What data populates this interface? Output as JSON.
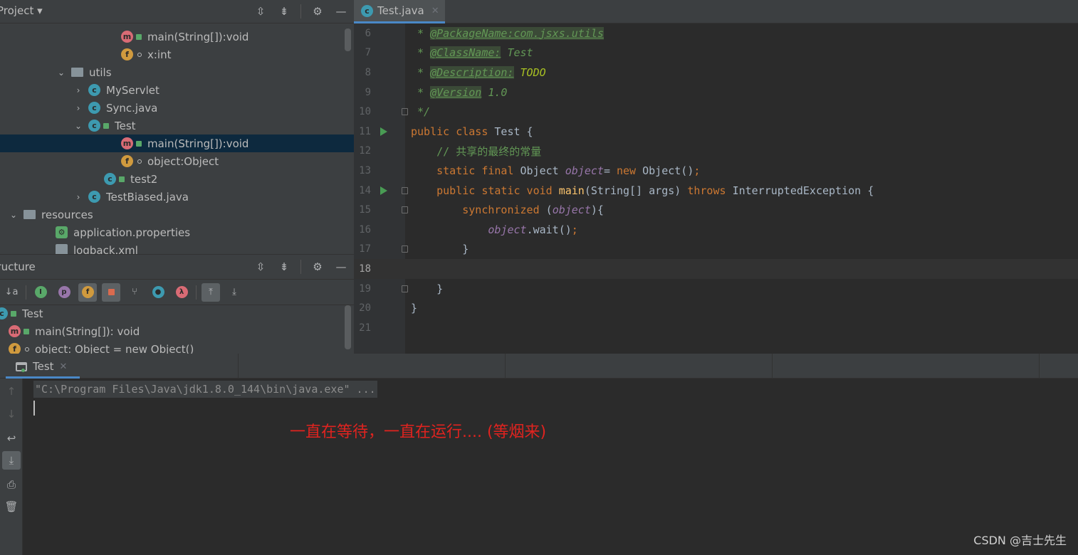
{
  "project_panel": {
    "title": "Project",
    "tree": [
      {
        "label": "main(String[]):void",
        "kind": "m",
        "lock": true
      },
      {
        "label": "x:int",
        "kind": "f",
        "dot": true
      },
      {
        "label": "utils",
        "kind": "folder",
        "arrow": "down"
      },
      {
        "label": "MyServlet",
        "kind": "c",
        "arrow": "right"
      },
      {
        "label": "Sync.java",
        "kind": "c",
        "arrow": "right"
      },
      {
        "label": "Test",
        "kind": "c",
        "arrow": "down",
        "lock": true
      },
      {
        "label": "main(String[]):void",
        "kind": "m",
        "lock": true,
        "selected": true
      },
      {
        "label": "object:Object",
        "kind": "f",
        "dot": true
      },
      {
        "label": "test2",
        "kind": "c",
        "lock": true
      },
      {
        "label": "TestBiased.java",
        "kind": "c",
        "arrow": "right"
      },
      {
        "label": "resources",
        "kind": "folder",
        "arrow": "down"
      },
      {
        "label": "application.properties",
        "kind": "props"
      },
      {
        "label": "logback.xml",
        "kind": "xml"
      }
    ]
  },
  "structure_panel": {
    "title": "Structure",
    "items": [
      {
        "label": "Test",
        "kind": "c"
      },
      {
        "label": "main(String[]): void",
        "kind": "m"
      },
      {
        "label": "object: Object = new Object()",
        "kind": "f"
      }
    ]
  },
  "editor": {
    "tab_label": "Test.java",
    "lines": [
      {
        "n": "6"
      },
      {
        "n": "7"
      },
      {
        "n": "8"
      },
      {
        "n": "9"
      },
      {
        "n": "10"
      },
      {
        "n": "11"
      },
      {
        "n": "12"
      },
      {
        "n": "13"
      },
      {
        "n": "14"
      },
      {
        "n": "15"
      },
      {
        "n": "16"
      },
      {
        "n": "17"
      },
      {
        "n": "18"
      },
      {
        "n": "19"
      },
      {
        "n": "20"
      },
      {
        "n": "21"
      }
    ],
    "code": {
      "l6_prefix": " * ",
      "l6_tag": "@PackageName:com.jsxs.utils",
      "l7_prefix": " * ",
      "l7_tag": "@ClassName:",
      "l7_val": " Test",
      "l8_prefix": " * ",
      "l8_tag": "@Description:",
      "l8_val": " TODO",
      "l9_prefix": " * ",
      "l9_tag": "@Version",
      "l9_val": " 1.0",
      "l10": " */",
      "l11_kw": "public class ",
      "l11_rest": "Test {",
      "l12": "    // 共享的最终的常量",
      "l13_kw": "    static final ",
      "l13_type": "Object ",
      "l13_fld": "object",
      "l13_eq": "= ",
      "l13_new": "new ",
      "l13_rest": "Object()",
      "l13_semi": ";",
      "l14_kw": "    public static void ",
      "l14_mth": "main",
      "l14_args": "(String[] args) ",
      "l14_throws": "throws ",
      "l14_rest": "InterruptedException {",
      "l15_kw": "        synchronized ",
      "l15_p1": "(",
      "l15_fld": "object",
      "l15_p2": "){",
      "l16_fld": "            object",
      "l16_rest": ".wait()",
      "l16_semi": ";",
      "l17": "        }",
      "l19": "    }",
      "l20": "}"
    }
  },
  "run_panel": {
    "tab_label": "Test",
    "command": "\"C:\\Program Files\\Java\\jdk1.8.0_144\\bin\\java.exe\" ...",
    "annotation": "一直在等待，一直在运行.... (等烟来)",
    "watermark": "CSDN @吉士先生"
  },
  "colors": {
    "annotation": "#e0231f",
    "selection": "#0d293e",
    "accent": "#4a88c7"
  }
}
